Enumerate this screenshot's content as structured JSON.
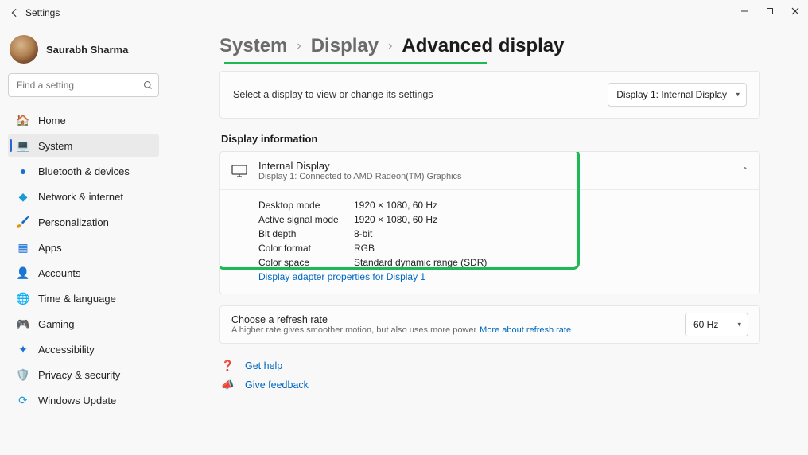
{
  "window": {
    "title": "Settings"
  },
  "user": {
    "name": "Saurabh Sharma"
  },
  "search": {
    "placeholder": "Find a setting"
  },
  "nav": {
    "home": "Home",
    "system": "System",
    "bluetooth": "Bluetooth & devices",
    "network": "Network & internet",
    "personalization": "Personalization",
    "apps": "Apps",
    "accounts": "Accounts",
    "time": "Time & language",
    "gaming": "Gaming",
    "accessibility": "Accessibility",
    "privacy": "Privacy & security",
    "update": "Windows Update"
  },
  "breadcrumb": {
    "system": "System",
    "display": "Display",
    "current": "Advanced display"
  },
  "selector": {
    "desc": "Select a display to view or change its settings",
    "value": "Display 1: Internal Display"
  },
  "section": {
    "info_title": "Display information"
  },
  "display": {
    "name": "Internal Display",
    "sub": "Display 1: Connected to AMD Radeon(TM) Graphics",
    "rows": {
      "desktop_mode": {
        "k": "Desktop mode",
        "v": "1920 × 1080, 60 Hz"
      },
      "active_signal": {
        "k": "Active signal mode",
        "v": "1920 × 1080, 60 Hz"
      },
      "bit_depth": {
        "k": "Bit depth",
        "v": "8-bit"
      },
      "color_format": {
        "k": "Color format",
        "v": "RGB"
      },
      "color_space": {
        "k": "Color space",
        "v": "Standard dynamic range (SDR)"
      }
    },
    "adapter_link": "Display adapter properties for Display 1"
  },
  "refresh": {
    "title": "Choose a refresh rate",
    "sub": "A higher rate gives smoother motion, but also uses more power",
    "more": "More about refresh rate",
    "value": "60 Hz"
  },
  "help": {
    "get_help": "Get help",
    "feedback": "Give feedback"
  }
}
